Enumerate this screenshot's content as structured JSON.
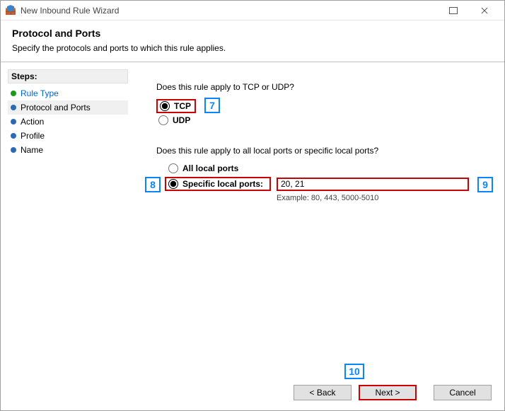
{
  "window": {
    "title": "New Inbound Rule Wizard"
  },
  "header": {
    "title": "Protocol and Ports",
    "subtitle": "Specify the protocols and ports to which this rule applies."
  },
  "sidebar": {
    "title": "Steps:",
    "items": [
      {
        "label": "Rule Type",
        "state": "completed"
      },
      {
        "label": "Protocol and Ports",
        "state": "current"
      },
      {
        "label": "Action",
        "state": "upcoming"
      },
      {
        "label": "Profile",
        "state": "upcoming"
      },
      {
        "label": "Name",
        "state": "upcoming"
      }
    ]
  },
  "content": {
    "question_protocol": "Does this rule apply to TCP or UDP?",
    "protocol_tcp_label": "TCP",
    "protocol_udp_label": "UDP",
    "protocol_selected": "TCP",
    "question_ports": "Does this rule apply to all local ports or specific local ports?",
    "ports_all_label": "All local ports",
    "ports_specific_label": "Specific local ports:",
    "ports_mode_selected": "specific",
    "ports_value": "20, 21",
    "ports_example": "Example: 80, 443, 5000-5010"
  },
  "buttons": {
    "back": "< Back",
    "next": "Next >",
    "cancel": "Cancel"
  },
  "annotations": {
    "n7": "7",
    "n8": "8",
    "n9": "9",
    "n10": "10"
  }
}
